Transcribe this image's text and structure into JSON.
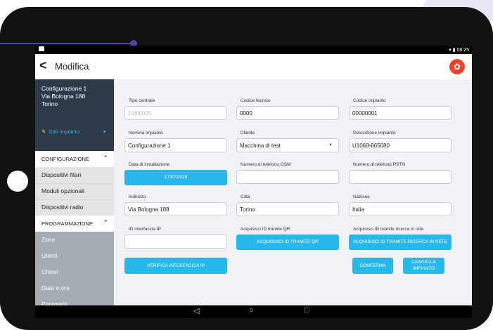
{
  "status": {
    "time": "08:25"
  },
  "appbar": {
    "title": "Modifica"
  },
  "sidebar": {
    "installation_lines": [
      "Configurazione 1",
      "Via Bologna 188",
      "Torino"
    ],
    "edit_label": "Dati impianto",
    "config_header": "CONFIGURAZIONE",
    "config_items": [
      "Dispositivi filari",
      "Moduli opzionali",
      "Dispositivi radio"
    ],
    "prog_header": "PROGRAMMAZIONE",
    "prog_items": [
      "Zone",
      "Utenti",
      "Chiavi",
      "Data e ora",
      "Parametri"
    ]
  },
  "form": {
    "tipo_centrale": {
      "label": "Tipo centrale",
      "value": "1068/005"
    },
    "codice_tecnico": {
      "label": "Codice tecnico",
      "value": "0000"
    },
    "codice_impianto": {
      "label": "Codice impianto",
      "value": "00000001"
    },
    "nomina_impianto": {
      "label": "Nomina impianto",
      "value": "Configurazione 1"
    },
    "cliente": {
      "label": "Cliente",
      "value": "Macchina di test"
    },
    "descrizione": {
      "label": "Descrizione impianto",
      "value": "U1068-865080"
    },
    "data_installazione": {
      "label": "Data di installazione",
      "value": "17/07/2019"
    },
    "telefono_gsm": {
      "label": "Numero di telefono GSM",
      "value": ""
    },
    "telefono_pstn": {
      "label": "Numero di telefono PSTN",
      "value": ""
    },
    "indirizzo": {
      "label": "Indirizzo",
      "value": "Via Bologna 188"
    },
    "citta": {
      "label": "Città",
      "value": "Torino"
    },
    "nazione": {
      "label": "Nazione",
      "value": "Italia"
    },
    "id_interfaccia": {
      "label": "ID interfaccia IP",
      "value": ""
    },
    "acq_qr": {
      "label": "Acquisisci ID tramite QR",
      "button": "ACQUISISCI ID TRAMITE QR"
    },
    "acq_rete": {
      "label": "Acquisisci ID tramite ricerca in rete",
      "button": "ACQUISISCI ID TRAMITE RICERCA IN RETE"
    },
    "verifica": "VERIFICA INTERFACCIA IP",
    "conferma": "CONFERMA",
    "cancella_line1": "CANCELLA",
    "cancella_line2": "IMPIANTO"
  },
  "colors": {
    "accent": "#29b6e8",
    "sidebar_dark": "#2d3a4a",
    "logo": "#e8432e"
  },
  "icons": [
    "back-arrow-icon",
    "brand-logo-icon",
    "pencil-icon",
    "chevron-up-icon",
    "nav-back-icon",
    "nav-home-icon",
    "nav-recents-icon",
    "wifi-icon",
    "battery-icon"
  ]
}
